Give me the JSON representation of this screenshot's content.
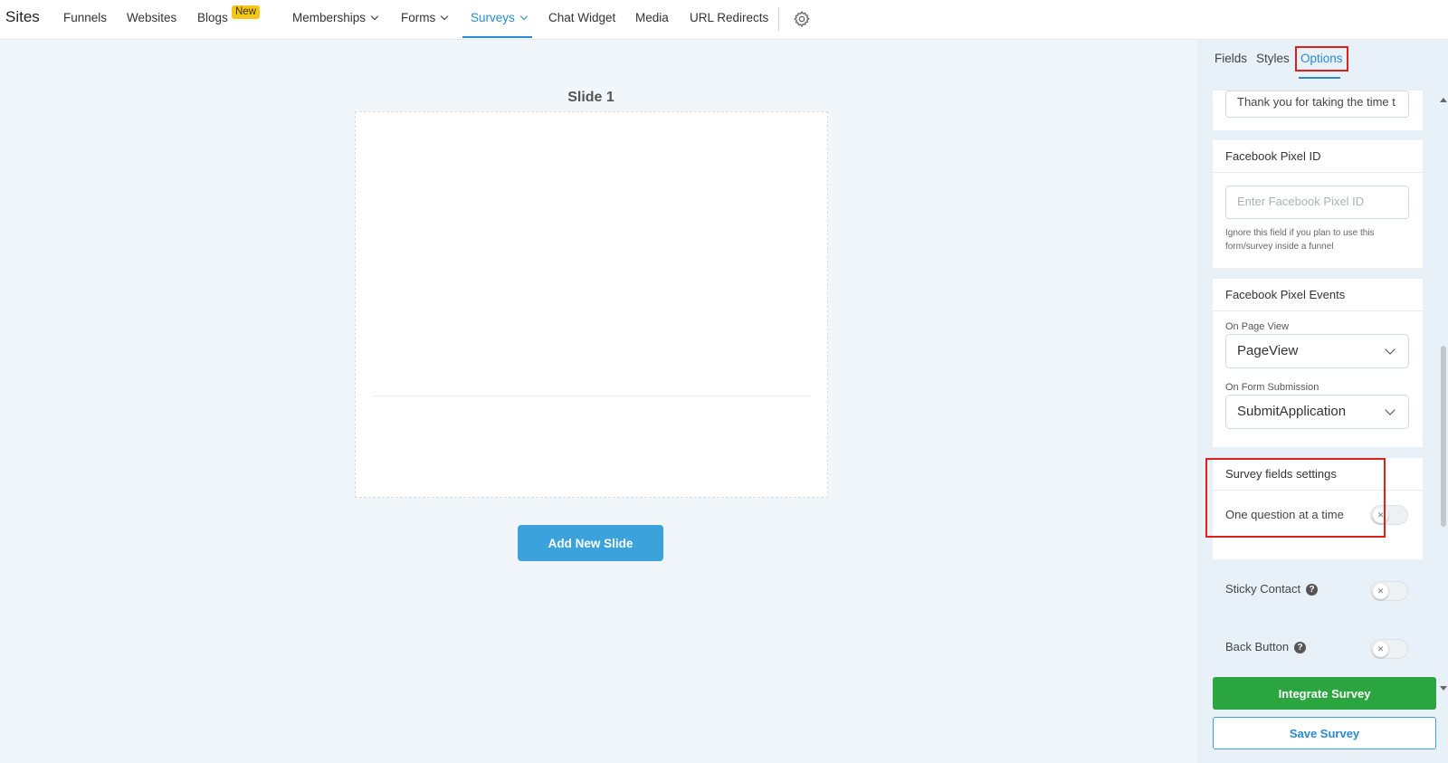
{
  "nav": {
    "brand": "Sites",
    "items": [
      {
        "label": "Funnels"
      },
      {
        "label": "Websites"
      },
      {
        "label": "Blogs",
        "badge": "New"
      },
      {
        "label": "Memberships"
      },
      {
        "label": "Forms"
      },
      {
        "label": "Surveys",
        "active": true
      },
      {
        "label": "Chat Widget"
      },
      {
        "label": "Media"
      },
      {
        "label": "URL Redirects"
      }
    ],
    "settings_icon": "gear-icon"
  },
  "canvas": {
    "slide_title": "Slide 1",
    "add_slide_label": "Add New Slide"
  },
  "panel": {
    "tabs": [
      {
        "label": "Fields"
      },
      {
        "label": "Styles"
      },
      {
        "label": "Options",
        "active": true
      }
    ],
    "thank_you_value": "Thank you for taking the time t",
    "pixel_id": {
      "title": "Facebook Pixel ID",
      "placeholder": "Enter Facebook Pixel ID",
      "hint": "Ignore this field if you plan to use this form/survey inside a funnel"
    },
    "pixel_events": {
      "title": "Facebook Pixel Events",
      "page_view_label": "On Page View",
      "page_view_value": "PageView",
      "form_submission_label": "On Form Submission",
      "form_submission_value": "SubmitApplication"
    },
    "survey_fields": {
      "title": "Survey fields settings",
      "one_question_label": "One question at a time",
      "one_question_enabled": false
    },
    "sticky_contact": {
      "label": "Sticky Contact",
      "enabled": false
    },
    "back_button": {
      "label": "Back Button",
      "enabled": false
    },
    "integrate_label": "Integrate Survey",
    "save_label": "Save Survey"
  },
  "colors": {
    "accent": "#2a8ad1",
    "add_slide_button": "#3ba2db",
    "integrate_button": "#2ba53f",
    "highlight_box": "#e0201d",
    "badge": "#f5c518"
  }
}
